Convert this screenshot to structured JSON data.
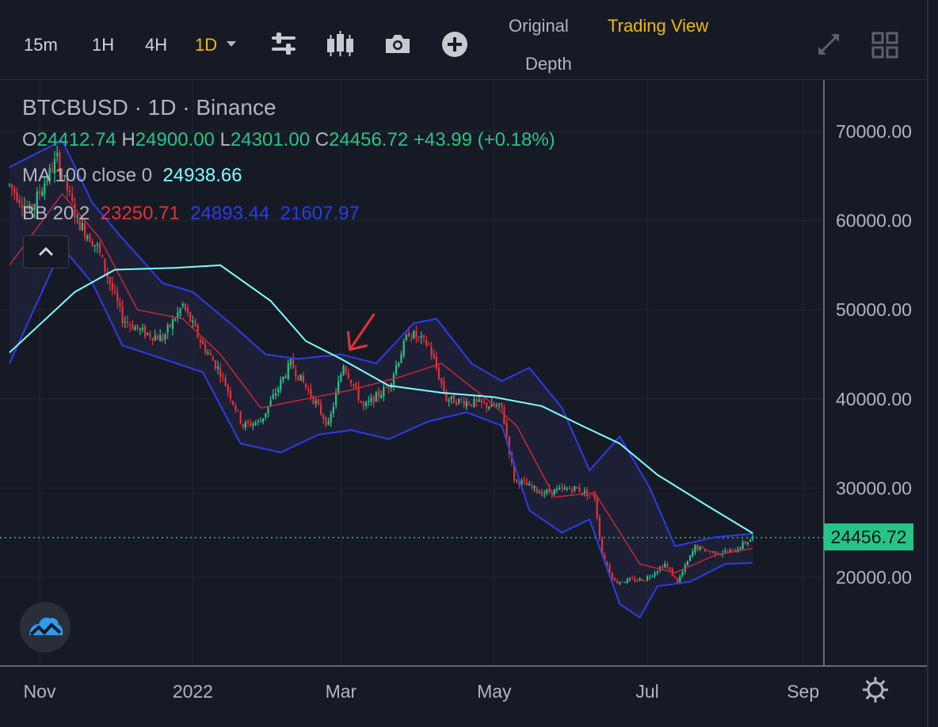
{
  "toolbar": {
    "timeframes": [
      "15m",
      "1H",
      "4H",
      "1D"
    ],
    "active_timeframe": "1D",
    "icons": [
      "indicator-settings-icon",
      "candle-style-icon",
      "camera-icon",
      "add-icon"
    ],
    "views": {
      "original": "Original",
      "trading_view": "Trading View",
      "depth": "Depth"
    },
    "right_icons": [
      "expand-icon",
      "layout-grid-icon"
    ]
  },
  "legend": {
    "symbol": "BTCBUSD · 1D · Binance",
    "ohlc": {
      "o_label": "O",
      "o": "24412.74",
      "h_label": "H",
      "h": "24900.00",
      "l_label": "L",
      "l": "24301.00",
      "c_label": "C",
      "c": "24456.72",
      "change": "+43.99",
      "change_pct": "(+0.18%)"
    },
    "ma": {
      "label": "MA 100 close 0",
      "value": "24938.66"
    },
    "bb": {
      "label": "BB 20 2",
      "basis": "23250.71",
      "upper": "24893.44",
      "lower": "21607.97"
    }
  },
  "colors": {
    "up": "#26C587",
    "down": "#E5313A",
    "ma": "#7FFFFF",
    "bb": "#2C3CE8",
    "basis": "#C9263A",
    "accent": "#F0B90B",
    "band_fill": "#1F2237",
    "grid": "#232733"
  },
  "current_price_label": "24456.72",
  "chart_data": {
    "type": "candlestick",
    "title": "BTCBUSD · 1D · Binance",
    "ylim": [
      13000,
      76000
    ],
    "y_ticks": [
      "70000.00",
      "60000.00",
      "50000.00",
      "40000.00",
      "30000.00",
      "20000.00"
    ],
    "x_ticks": [
      "Nov",
      "2022",
      "Mar",
      "May",
      "Jul",
      "Sep"
    ],
    "current_price": 24456.72,
    "close_path": [
      [
        "2021-10-20",
        64000
      ],
      [
        "2021-10-28",
        61000
      ],
      [
        "2021-11-08",
        67000
      ],
      [
        "2021-11-16",
        60000
      ],
      [
        "2021-11-24",
        57000
      ],
      [
        "2021-12-04",
        49000
      ],
      [
        "2021-12-12",
        47500
      ],
      [
        "2021-12-20",
        46800
      ],
      [
        "2021-12-28",
        50500
      ],
      [
        "2022-01-05",
        46000
      ],
      [
        "2022-01-12",
        43000
      ],
      [
        "2022-01-21",
        37000
      ],
      [
        "2022-01-28",
        37500
      ],
      [
        "2022-02-09",
        44000
      ],
      [
        "2022-02-18",
        40000
      ],
      [
        "2022-02-24",
        37000
      ],
      [
        "2022-03-02",
        44000
      ],
      [
        "2022-03-10",
        39000
      ],
      [
        "2022-03-20",
        41500
      ],
      [
        "2022-03-28",
        47500
      ],
      [
        "2022-04-05",
        46000
      ],
      [
        "2022-04-12",
        40000
      ],
      [
        "2022-04-24",
        39500
      ],
      [
        "2022-05-04",
        39000
      ],
      [
        "2022-05-09",
        31000
      ],
      [
        "2022-05-20",
        29500
      ],
      [
        "2022-06-02",
        30000
      ],
      [
        "2022-06-10",
        29000
      ],
      [
        "2022-06-13",
        22500
      ],
      [
        "2022-06-18",
        19500
      ],
      [
        "2022-06-30",
        19800
      ],
      [
        "2022-07-08",
        21500
      ],
      [
        "2022-07-13",
        19500
      ],
      [
        "2022-07-20",
        23400
      ],
      [
        "2022-07-27",
        22800
      ],
      [
        "2022-08-04",
        22900
      ],
      [
        "2022-08-12",
        24456
      ]
    ],
    "ma100_path": [
      [
        "2021-10-20",
        45200
      ],
      [
        "2021-11-15",
        52000
      ],
      [
        "2021-12-01",
        54500
      ],
      [
        "2021-12-25",
        54700
      ],
      [
        "2022-01-12",
        55000
      ],
      [
        "2022-02-01",
        51000
      ],
      [
        "2022-02-15",
        46500
      ],
      [
        "2022-03-01",
        44500
      ],
      [
        "2022-03-20",
        41500
      ],
      [
        "2022-04-10",
        40700
      ],
      [
        "2022-05-01",
        40200
      ],
      [
        "2022-05-20",
        39200
      ],
      [
        "2022-06-05",
        37000
      ],
      [
        "2022-06-20",
        35000
      ],
      [
        "2022-07-05",
        31500
      ],
      [
        "2022-07-25",
        28000
      ],
      [
        "2022-08-12",
        24938
      ]
    ],
    "bb_upper_path": [
      [
        "2021-10-20",
        66000
      ],
      [
        "2021-11-10",
        69000
      ],
      [
        "2021-11-22",
        62000
      ],
      [
        "2021-12-04",
        58000
      ],
      [
        "2021-12-20",
        53000
      ],
      [
        "2022-01-01",
        52000
      ],
      [
        "2022-01-18",
        48000
      ],
      [
        "2022-01-30",
        45000
      ],
      [
        "2022-02-12",
        44500
      ],
      [
        "2022-03-01",
        45000
      ],
      [
        "2022-03-15",
        44000
      ],
      [
        "2022-03-30",
        48500
      ],
      [
        "2022-04-08",
        49000
      ],
      [
        "2022-04-22",
        44000
      ],
      [
        "2022-05-04",
        42000
      ],
      [
        "2022-05-15",
        43500
      ],
      [
        "2022-05-28",
        39000
      ],
      [
        "2022-06-08",
        32000
      ],
      [
        "2022-06-20",
        35800
      ],
      [
        "2022-07-02",
        30000
      ],
      [
        "2022-07-12",
        23500
      ],
      [
        "2022-07-28",
        24500
      ],
      [
        "2022-08-12",
        24893
      ]
    ],
    "bb_lower_path": [
      [
        "2021-10-20",
        44000
      ],
      [
        "2021-11-10",
        57000
      ],
      [
        "2021-11-22",
        53000
      ],
      [
        "2021-12-04",
        46000
      ],
      [
        "2021-12-20",
        44500
      ],
      [
        "2022-01-05",
        43000
      ],
      [
        "2022-01-20",
        35000
      ],
      [
        "2022-02-05",
        34000
      ],
      [
        "2022-02-20",
        36000
      ],
      [
        "2022-03-05",
        36500
      ],
      [
        "2022-03-20",
        35500
      ],
      [
        "2022-04-05",
        37500
      ],
      [
        "2022-04-20",
        38500
      ],
      [
        "2022-05-04",
        37000
      ],
      [
        "2022-05-15",
        27500
      ],
      [
        "2022-05-28",
        25000
      ],
      [
        "2022-06-08",
        26500
      ],
      [
        "2022-06-20",
        17000
      ],
      [
        "2022-06-28",
        15500
      ],
      [
        "2022-07-05",
        19000
      ],
      [
        "2022-07-18",
        19500
      ],
      [
        "2022-08-01",
        21500
      ],
      [
        "2022-08-12",
        21608
      ]
    ],
    "bb_basis_path": [
      [
        "2021-10-20",
        55000
      ],
      [
        "2021-11-10",
        63000
      ],
      [
        "2021-11-25",
        58000
      ],
      [
        "2021-12-10",
        50000
      ],
      [
        "2021-12-28",
        49000
      ],
      [
        "2022-01-12",
        45000
      ],
      [
        "2022-01-28",
        39000
      ],
      [
        "2022-02-15",
        40000
      ],
      [
        "2022-03-05",
        41000
      ],
      [
        "2022-03-25",
        42500
      ],
      [
        "2022-04-10",
        44000
      ],
      [
        "2022-04-28",
        40000
      ],
      [
        "2022-05-10",
        37000
      ],
      [
        "2022-05-25",
        29000
      ],
      [
        "2022-06-10",
        29500
      ],
      [
        "2022-06-28",
        21500
      ],
      [
        "2022-07-12",
        20500
      ],
      [
        "2022-07-28",
        22500
      ],
      [
        "2022-08-12",
        23250
      ]
    ],
    "annotation": {
      "type": "arrow",
      "color": "#E5313A",
      "points_to": [
        "2022-03-02",
        45000
      ]
    }
  }
}
